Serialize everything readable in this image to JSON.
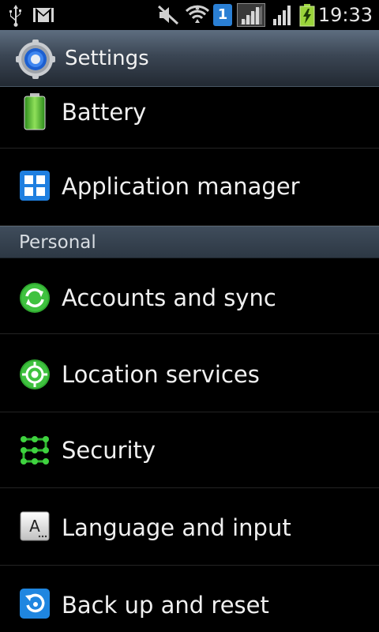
{
  "status_bar": {
    "time": "19:33",
    "sim_badge": "1",
    "icons": [
      "usb-icon",
      "gmail-icon",
      "mute-icon",
      "wifi-icon",
      "sim-icon",
      "signal-icon",
      "signal-icon",
      "battery-charging-icon"
    ]
  },
  "action_bar": {
    "title": "Settings",
    "icon": "settings-gear-icon"
  },
  "items_top": [
    {
      "label": "Battery",
      "icon": "battery-icon"
    },
    {
      "label": "Application manager",
      "icon": "app-grid-icon"
    }
  ],
  "section": {
    "label": "Personal"
  },
  "items": [
    {
      "label": "Accounts and sync",
      "icon": "sync-icon"
    },
    {
      "label": "Location services",
      "icon": "location-icon"
    },
    {
      "label": "Security",
      "icon": "pattern-lock-icon"
    },
    {
      "label": "Language and input",
      "icon": "keyboard-a-icon"
    },
    {
      "label": "Back up and reset",
      "icon": "backup-icon"
    }
  ],
  "colors": {
    "accent_green": "#3bb53b",
    "action_bar_top": "#5e6e80",
    "action_bar_bottom": "#222932",
    "section_bg": "#3a4755",
    "text": "#f0f0f0",
    "background": "#000000"
  }
}
